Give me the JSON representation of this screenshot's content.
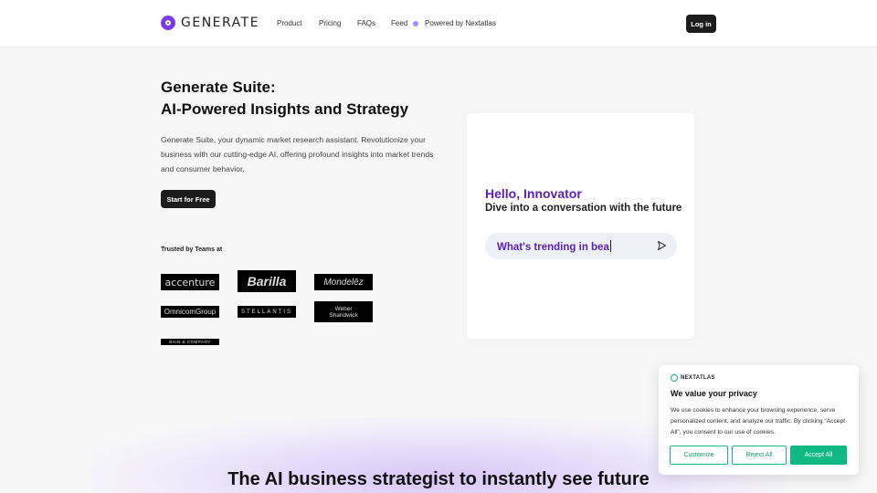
{
  "header": {
    "logo_text": "GENERATE",
    "nav": [
      "Product",
      "Pricing",
      "FAQs",
      "Feed"
    ],
    "powered_by": "Powered by Nextatlas",
    "login_label": "Log in"
  },
  "hero": {
    "title_line1": "Generate Suite:",
    "title_line2": "AI-Powered Insights and Strategy",
    "description": "Generate Suite, your dynamic market research assistant. Revolutionize your business with our cutting-edge AI, offering profound insights into market trends and consumer behavior.",
    "cta_label": "Start for Free",
    "trusted_label": "Trusted by Teams at",
    "brands": [
      "accenture",
      "Barilla",
      "Mondelēz",
      "OmnicomGroup",
      "STELLANTIS",
      "Weber Shandwick",
      "BAIN & COMPANY"
    ]
  },
  "chat_card": {
    "greeting": "Hello, Innovator",
    "subtitle": "Dive into a conversation with the future",
    "input_value": "What's trending in bea",
    "send_icon": "send-icon"
  },
  "bottom": {
    "headline": "The AI business strategist to instantly see future"
  },
  "cookie": {
    "logo_text": "NEXTATLAS",
    "title": "We value your privacy",
    "body": "We use cookies to enhance your browsing experience, serve personalized content, and analyze our traffic. By clicking \"Accept All\", you consent to our use of cookies.",
    "customize_label": "Customize",
    "reject_label": "Reject All",
    "accept_label": "Accept All"
  },
  "colors": {
    "accent": "#7c3aed",
    "greeting": "#5b21b6",
    "cookie_green": "#10b981",
    "dark_button": "#1c1c1c"
  }
}
